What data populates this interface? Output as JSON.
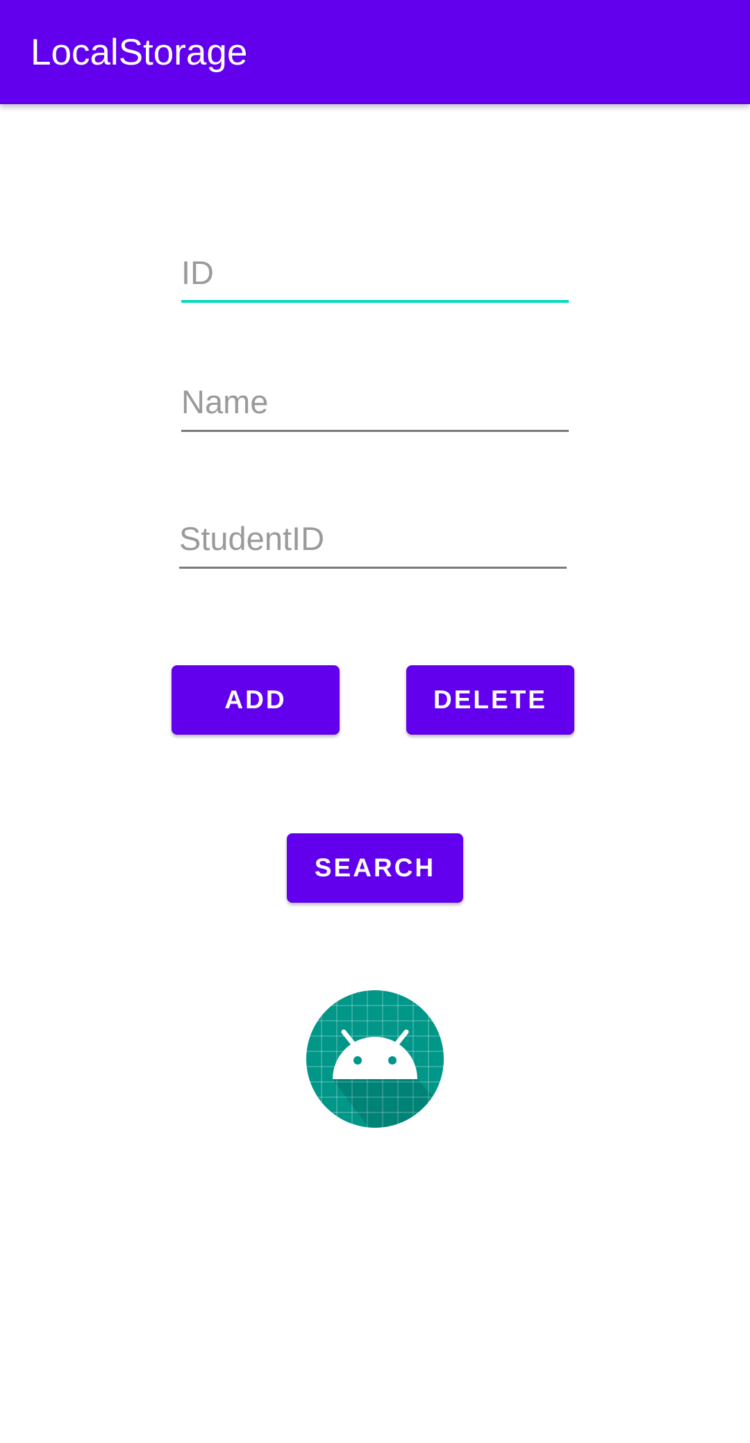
{
  "app_bar": {
    "title": "LocalStorage",
    "color": "#6200EE"
  },
  "form": {
    "id_field": {
      "placeholder": "ID",
      "value": ""
    },
    "name_field": {
      "placeholder": "Name",
      "value": ""
    },
    "student_id_field": {
      "placeholder": "StudentID",
      "value": ""
    }
  },
  "actions": {
    "add_label": "ADD",
    "delete_label": "DELETE",
    "search_label": "SEARCH"
  },
  "logo": {
    "icon": "android-icon",
    "background": "#009688"
  },
  "colors": {
    "primary": "#6200EE",
    "accent": "#03DAC5"
  }
}
